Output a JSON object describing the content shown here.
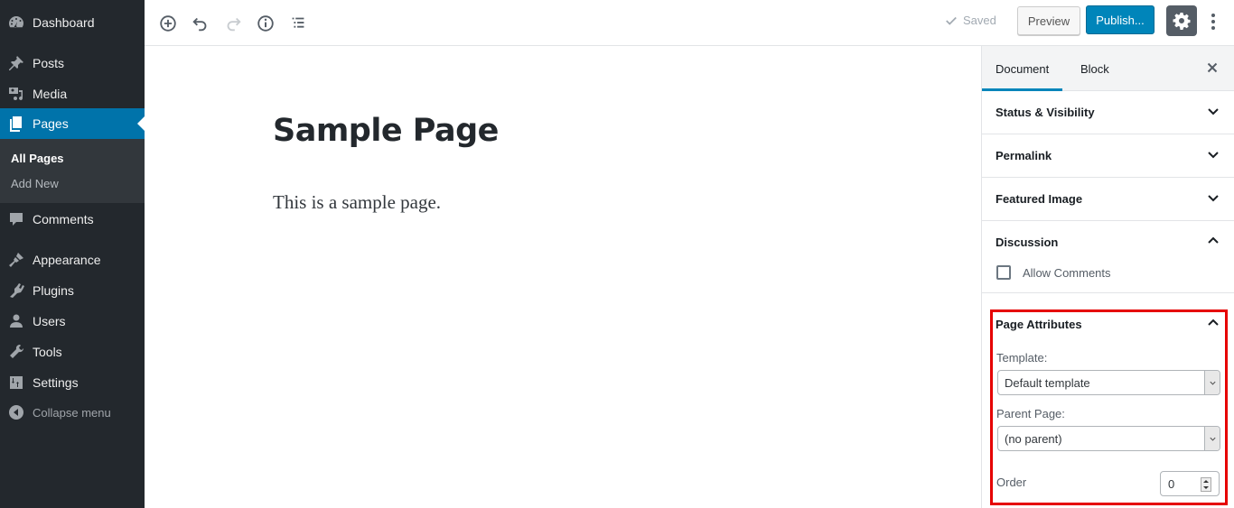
{
  "admin_menu": {
    "items": [
      {
        "label": "Dashboard",
        "icon": "dashboard-icon"
      },
      {
        "label": "Posts",
        "icon": "pushpin-icon"
      },
      {
        "label": "Media",
        "icon": "media-icon"
      },
      {
        "label": "Pages",
        "icon": "pages-icon",
        "active": true
      },
      {
        "label": "Comments",
        "icon": "comment-icon"
      },
      {
        "label": "Appearance",
        "icon": "paintbrush-icon"
      },
      {
        "label": "Plugins",
        "icon": "plugin-icon"
      },
      {
        "label": "Users",
        "icon": "user-icon"
      },
      {
        "label": "Tools",
        "icon": "wrench-icon"
      },
      {
        "label": "Settings",
        "icon": "settings-sliders-icon"
      }
    ],
    "submenu": [
      {
        "label": "All Pages",
        "current": true
      },
      {
        "label": "Add New"
      }
    ],
    "collapse_label": "Collapse menu",
    "active_color": "#0073aa",
    "bg_color": "#23282d"
  },
  "toolbar": {
    "icons": [
      "add-block-icon",
      "undo-icon",
      "redo-icon",
      "info-icon",
      "outline-icon"
    ],
    "saved_label": "Saved",
    "preview_label": "Preview",
    "publish_label": "Publish...",
    "publish_color": "#0085ba"
  },
  "editor": {
    "title": "Sample Page",
    "body": "This is a sample page."
  },
  "panel": {
    "tabs": [
      {
        "label": "Document",
        "active": true
      },
      {
        "label": "Block"
      }
    ],
    "sections": [
      {
        "label": "Status & Visibility",
        "expanded": false
      },
      {
        "label": "Permalink",
        "expanded": false
      },
      {
        "label": "Featured Image",
        "expanded": false
      },
      {
        "label": "Discussion",
        "expanded": true
      }
    ],
    "discussion": {
      "allow_comments_label": "Allow Comments",
      "allow_comments_checked": false
    },
    "page_attributes": {
      "label": "Page Attributes",
      "template_label": "Template:",
      "template_value": "Default template",
      "parent_label": "Parent Page:",
      "parent_value": "(no parent)",
      "order_label": "Order",
      "order_value": "0",
      "highlight_color": "#e60000"
    }
  }
}
